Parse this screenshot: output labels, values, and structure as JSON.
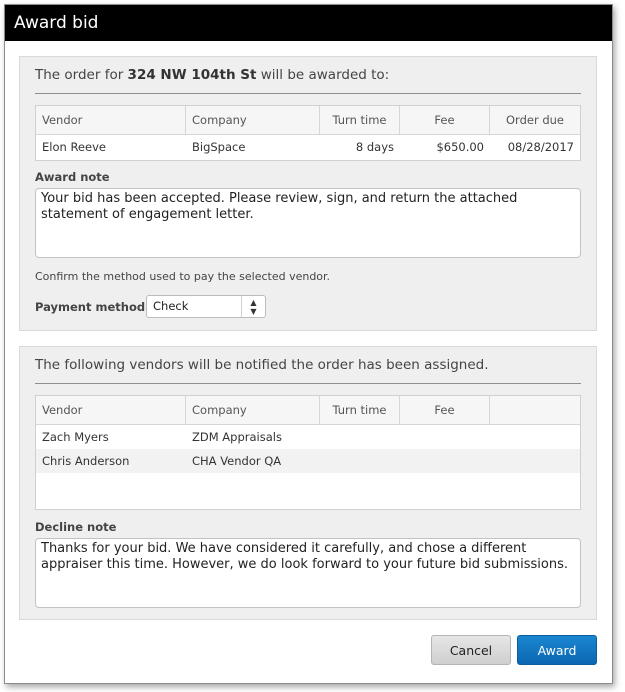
{
  "dialog": {
    "title": "Award bid"
  },
  "award_panel": {
    "header_prefix": "The order for ",
    "header_address": "324 NW 104th St",
    "header_suffix": " will be awarded to:",
    "columns": {
      "vendor": "Vendor",
      "company": "Company",
      "turn_time": "Turn time",
      "fee": "Fee",
      "order_due": "Order due"
    },
    "rows": [
      {
        "vendor": "Elon Reeve",
        "company": "BigSpace",
        "turn_time": "8 days",
        "fee": "$650.00",
        "order_due": "08/28/2017"
      }
    ],
    "award_note_label": "Award note",
    "award_note": "Your bid has been accepted. Please review, sign, and return the attached\nstatement of engagement letter.",
    "confirm_hint": "Confirm the method used to pay the selected vendor.",
    "payment_method_label": "Payment method",
    "payment_method_value": "Check"
  },
  "notify_panel": {
    "header": "The following vendors will be notified the order has been assigned.",
    "columns": {
      "vendor": "Vendor",
      "company": "Company",
      "turn_time": "Turn time",
      "fee": "Fee"
    },
    "rows": [
      {
        "vendor": "Zach Myers",
        "company": "ZDM Appraisals"
      },
      {
        "vendor": "Chris Anderson",
        "company": "CHA Vendor QA"
      }
    ],
    "decline_note_label": "Decline note",
    "decline_note": "Thanks for your bid. We have considered it carefully, and chose a different\nappraiser this time. However, we do look forward to your future bid submissions."
  },
  "buttons": {
    "cancel": "Cancel",
    "award": "Award"
  },
  "colors": {
    "title_bar": "#000000",
    "award_button": "#0b6fbd",
    "panel_bg": "#efefef"
  },
  "icons": {
    "select_arrows": "updown-arrows-icon"
  }
}
